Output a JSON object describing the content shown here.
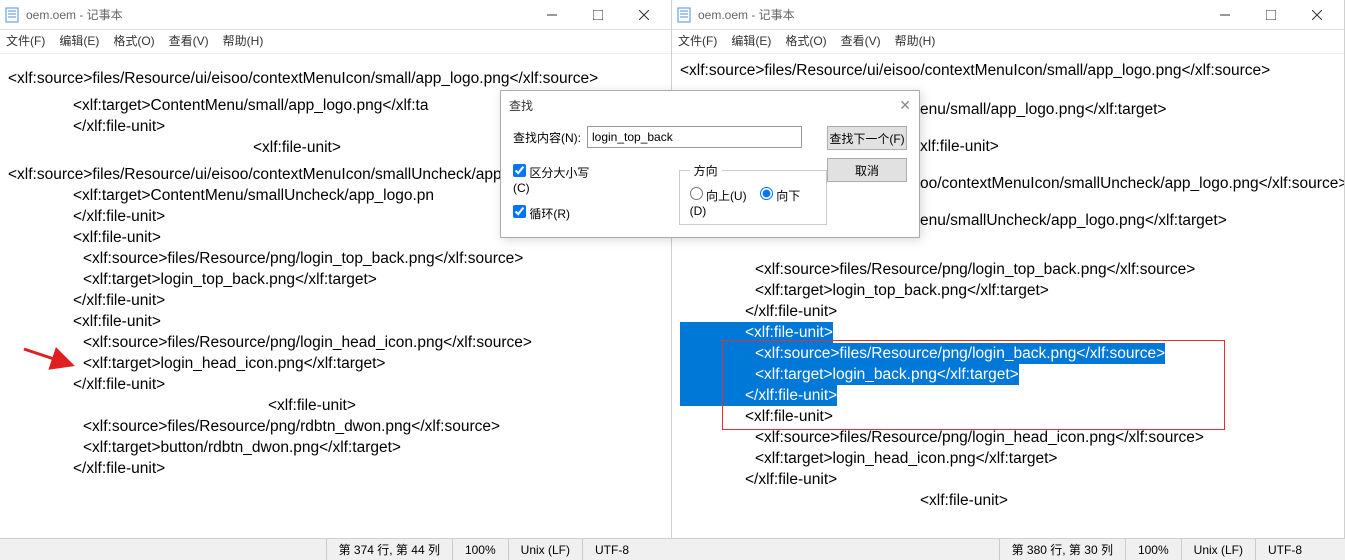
{
  "app": {
    "title": "oem.oem - 记事本",
    "icon": "notepad-icon"
  },
  "menubar": {
    "file": "文件(F)",
    "edit": "编辑(E)",
    "format": "格式(O)",
    "view": "查看(V)",
    "help": "帮助(H)"
  },
  "left": {
    "lines": {
      "l1": "<xlf:source>files/Resource/ui/eisoo/contextMenuIcon/small/app_logo.png</xlf:source>",
      "l2": "<xlf:target>ContentMenu/small/app_logo.png</xlf:ta",
      "l3": "</xlf:file-unit>",
      "l4": "<xlf:file-unit>",
      "l5": "<xlf:source>files/Resource/ui/eisoo/contextMenuIcon/smallUncheck/app_logo.png</xlf:source>",
      "l6": "<xlf:target>ContentMenu/smallUncheck/app_logo.pn",
      "l7": "</xlf:file-unit>",
      "l8": "<xlf:file-unit>",
      "l9": "<xlf:source>files/Resource/png/login_top_back.png</xlf:source>",
      "l10": "<xlf:target>login_top_back.png</xlf:target>",
      "l11": "</xlf:file-unit>",
      "l12": "<xlf:file-unit>",
      "l13": "<xlf:source>files/Resource/png/login_head_icon.png</xlf:source>",
      "l14": "<xlf:target>login_head_icon.png</xlf:target>",
      "l15": "</xlf:file-unit>",
      "l16": "<xlf:file-unit>",
      "l17": "<xlf:source>files/Resource/png/rdbtn_dwon.png</xlf:source>",
      "l18": "<xlf:target>button/rdbtn_dwon.png</xlf:target>",
      "l19": "</xlf:file-unit>"
    },
    "status": {
      "pos": "第 374 行, 第 44 列",
      "zoom": "100%",
      "eol": "Unix (LF)",
      "enc": "UTF-8"
    }
  },
  "right": {
    "lines": {
      "l1": "<xlf:source>files/Resource/ui/eisoo/contextMenuIcon/small/app_logo.png</xlf:source>",
      "l2": "enu/small/app_logo.png</xlf:target>",
      "l3": "xlf:file-unit>",
      "l4": "oo/contextMenuIcon/smallUncheck/app_logo.png</xlf:source>",
      "l5": "enu/smallUncheck/app_logo.png</xlf:target>",
      "l6": "<xlf:source>files/Resource/png/login_top_back.png</xlf:source>",
      "l7": "<xlf:target>login_top_back.png</xlf:target>",
      "l8": "</xlf:file-unit>",
      "l9": "<xlf:file-unit>",
      "l10": "<xlf:source>files/Resource/png/login_back.png</xlf:source>",
      "l11": "<xlf:target>login_back.png</xlf:target>",
      "l12": "</xlf:file-unit>",
      "l13": "<xlf:file-unit>",
      "l14": "<xlf:source>files/Resource/png/login_head_icon.png</xlf:source>",
      "l15": "<xlf:target>login_head_icon.png</xlf:target>",
      "l16": "</xlf:file-unit>",
      "l17": "<xlf:file-unit>"
    },
    "status": {
      "pos": "第 380 行, 第 30 列",
      "zoom": "100%",
      "eol": "Unix (LF)",
      "enc": "UTF-8"
    }
  },
  "dialog": {
    "title": "查找",
    "content_label": "查找内容(N):",
    "value": "login_top_back",
    "find_next": "查找下一个(F)",
    "cancel": "取消",
    "direction": "方向",
    "up": "向上(U)",
    "down": "向下(D)",
    "match_case": "区分大小写(C)",
    "wrap": "循环(R)"
  }
}
